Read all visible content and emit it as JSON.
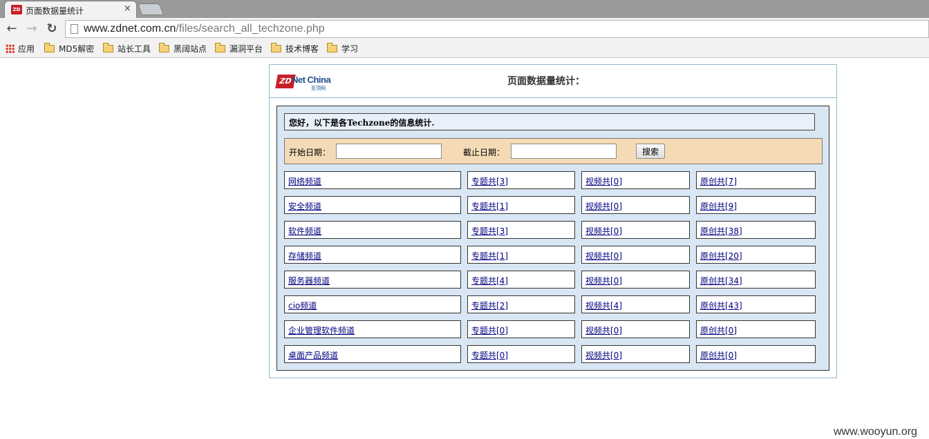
{
  "browser": {
    "tab_title": "页面数据量统计",
    "tab_favicon_text": "ZD",
    "tab_close": "×",
    "nav_back": "←",
    "nav_forward": "→",
    "nav_reload": "↻",
    "url_host": "www.zdnet.com.cn",
    "url_path": "/files/search_all_techzone.php",
    "bookmarks": [
      {
        "label": "应用",
        "icon": "apps-grid-icon"
      },
      {
        "label": "MD5解密",
        "icon": "folder-icon"
      },
      {
        "label": "站长工具",
        "icon": "folder-icon"
      },
      {
        "label": "黑阔站点",
        "icon": "folder-icon"
      },
      {
        "label": "漏洞平台",
        "icon": "folder-icon"
      },
      {
        "label": "技术博客",
        "icon": "folder-icon"
      },
      {
        "label": "学习",
        "icon": "folder-icon"
      }
    ]
  },
  "page": {
    "logo": {
      "mark": "ZD",
      "name": "Net China",
      "sub": "至顶网"
    },
    "title": "页面数据量统计：",
    "greeting": "您好，以下是各Techzone的信息统计.",
    "search": {
      "start_label": "开始日期：",
      "start_value": "",
      "end_label": "截止日期：",
      "end_value": "",
      "button": "搜索"
    },
    "rows": [
      {
        "channel": "网络频道",
        "topics": "专题共[3]",
        "videos": "视频共[0]",
        "originals": "原创共[7]"
      },
      {
        "channel": "安全频道",
        "topics": "专题共[1]",
        "videos": "视频共[0]",
        "originals": "原创共[9]"
      },
      {
        "channel": "软件频道",
        "topics": "专题共[3]",
        "videos": "视频共[0]",
        "originals": "原创共[38]"
      },
      {
        "channel": "存储频道",
        "topics": "专题共[1]",
        "videos": "视频共[0]",
        "originals": "原创共[20]"
      },
      {
        "channel": "服务器频道",
        "topics": "专题共[4]",
        "videos": "视频共[0]",
        "originals": "原创共[34]"
      },
      {
        "channel": "cio频道",
        "topics": "专题共[2]",
        "videos": "视频共[4]",
        "originals": "原创共[43]"
      },
      {
        "channel": "企业管理软件频道",
        "topics": "专题共[0]",
        "videos": "视频共[0]",
        "originals": "原创共[0]"
      },
      {
        "channel": "桌面产品频道",
        "topics": "专题共[0]",
        "videos": "视频共[0]",
        "originals": "原创共[0]"
      }
    ]
  },
  "watermark": "www.wooyun.org",
  "colors": {
    "panel_bg": "#d9e6f3",
    "search_bar_bg": "#f4dbb6",
    "link": "#000080",
    "brand_red": "#c8202a"
  }
}
